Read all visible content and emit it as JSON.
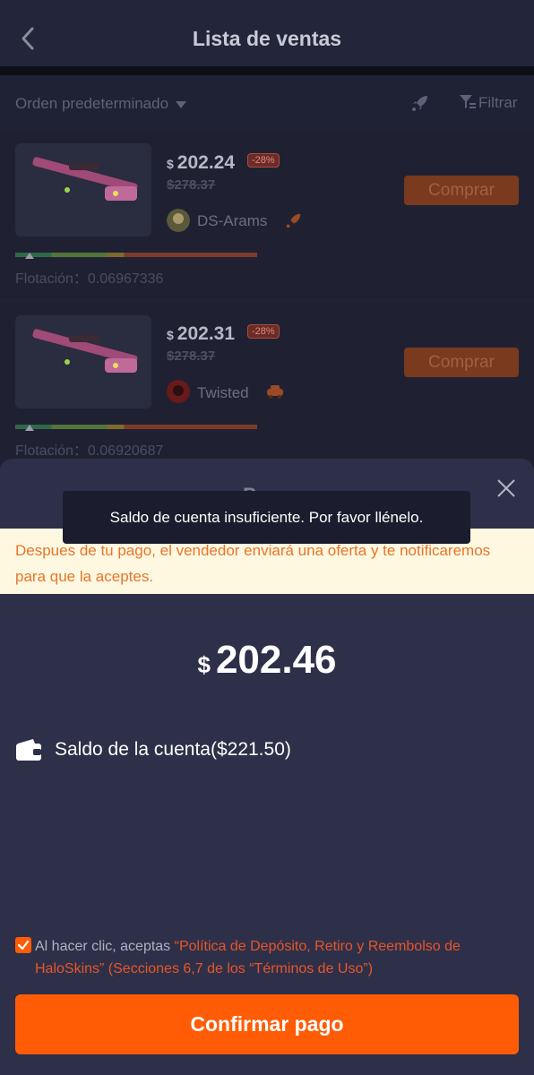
{
  "header": {
    "title": "Lista de ventas"
  },
  "sortbar": {
    "sort_label": "Orden predeterminado",
    "filter_label": "Filtrar"
  },
  "listings": [
    {
      "price": "202.24",
      "discount": "-28%",
      "old_price": "$278.37",
      "seller": "DS-Arams",
      "buy_label": "Comprar",
      "float_label": "Flotación：0.06967336",
      "float_value": 0.0697
    },
    {
      "price": "202.31",
      "discount": "-28%",
      "old_price": "$278.37",
      "seller": "Twisted",
      "buy_label": "Comprar",
      "float_label": "Flotación：0.06920687",
      "float_value": 0.0692
    }
  ],
  "currency_symbol": "$",
  "modal": {
    "title": "Pago",
    "toast": "Saldo de cuenta insuficiente. Por favor llénelo.",
    "notice": "Despues de tu pago, el vendedor enviará una oferta y te notificaremos para que la aceptes.",
    "amount": "202.46",
    "balance_label": "Saldo de la cuenta($221.50)",
    "terms_prefix": "Al hacer clic, aceptas ",
    "terms_link": "“Política de Depósito, Retiro y Reembolso de HaloSkins” (Secciones 6,7 de los “Términos de Uso”)",
    "confirm_label": "Confirmar pago"
  },
  "colors": {
    "accent": "#ff5c05",
    "modal_bg": "#2e3049",
    "notice_bg": "#fff8e1",
    "notice_text": "#e8742a"
  }
}
